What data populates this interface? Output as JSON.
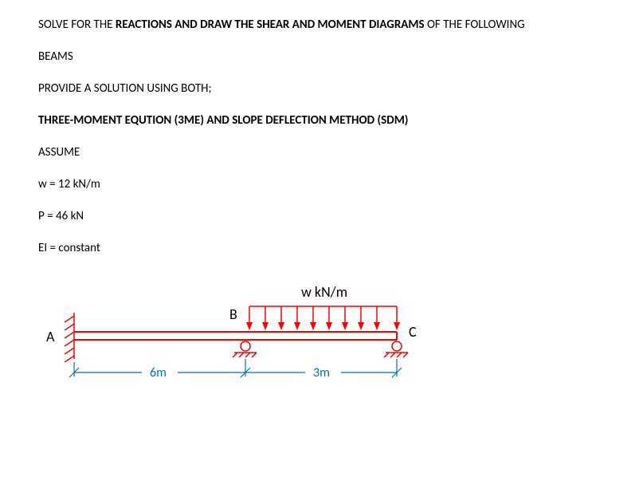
{
  "text": {
    "line1a": "SOLVE FOR THE ",
    "line1b": "REACTIONS AND DRAW THE SHEAR AND MOMENT DIAGRAMS",
    "line1c": " OF THE FOLLOWING",
    "line2": "BEAMS",
    "line3": "PROVIDE A SOLUTION USING BOTH;",
    "line4": "THREE-MOMENT EQUTION (3ME) AND SLOPE DEFLECTION METHOD (SDM)",
    "line5": "ASSUME",
    "line6": "w = 12 kN/m",
    "line7": "P = 46 kN",
    "line8": "EI = constant"
  },
  "diagram": {
    "labelA": "A",
    "labelB": "B",
    "labelC": "C",
    "load": "w kN/m",
    "span1": "6m",
    "span2": "3m"
  }
}
